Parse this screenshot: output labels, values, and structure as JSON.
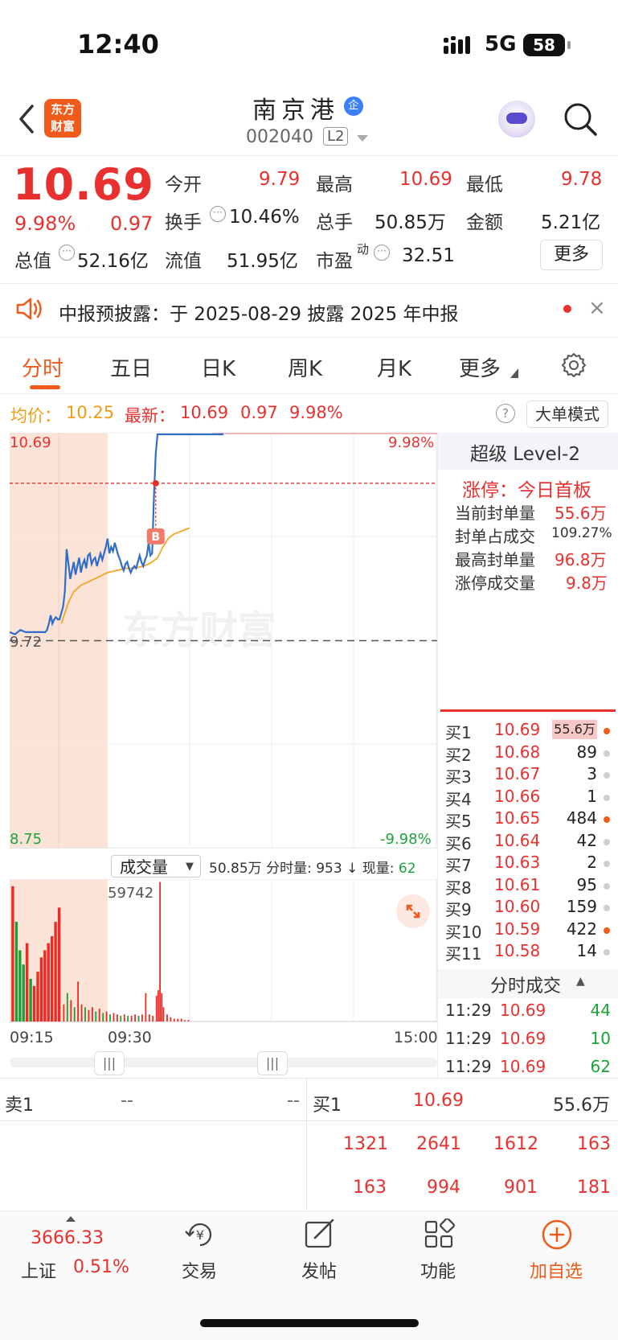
{
  "status_bar": {
    "time": "12:40",
    "network": "5G",
    "battery": "58"
  },
  "nav": {
    "logo_line1": "东方",
    "logo_line2": "财富",
    "stock_name": "南京港",
    "qi_badge": "企",
    "stock_code": "002040",
    "level_badge": "L2"
  },
  "quote": {
    "price": "10.69",
    "change_pct": "9.98%",
    "change_amt": "0.97",
    "stats": [
      {
        "label": "今开",
        "value": "9.79"
      },
      {
        "label": "最高",
        "value": "10.69"
      },
      {
        "label": "最低",
        "value": "9.78"
      },
      {
        "label": "换手",
        "value": "10.46%"
      },
      {
        "label": "总手",
        "value": "50.85万"
      },
      {
        "label": "金额",
        "value": "5.21亿"
      },
      {
        "label": "总值",
        "value": "52.16亿"
      },
      {
        "label": "流值",
        "value": "51.95亿"
      },
      {
        "label": "市盈",
        "sup": "动",
        "value": "32.51"
      }
    ],
    "more_label": "更多"
  },
  "notice": {
    "text": "中报预披露：于 2025-08-29 披露 2025 年中报",
    "close": "×"
  },
  "tabs": [
    {
      "label": "分时",
      "active": true
    },
    {
      "label": "五日"
    },
    {
      "label": "日K"
    },
    {
      "label": "周K"
    },
    {
      "label": "月K"
    },
    {
      "label": "更多"
    }
  ],
  "chart_header": {
    "avg_label": "均价：",
    "avg_value": "10.25",
    "latest_label": "最新：",
    "latest_value": "10.69",
    "latest_change": "0.97",
    "latest_pct": "9.98%",
    "help": "?",
    "big_order_mode": "大单模式"
  },
  "chart_data": {
    "type": "line",
    "title": "",
    "y_labels": {
      "top": "10.69",
      "mid": "9.72",
      "bottom": "8.75",
      "top_pct": "9.98%",
      "bottom_pct": "-9.98%"
    },
    "ylim": [
      8.75,
      10.69
    ],
    "prev_close": 9.72,
    "limit_line": 10.46,
    "x_labels": [
      "09:15",
      "09:30",
      "15:00"
    ],
    "watermark": "东方财富",
    "buy_marker": "B",
    "series": [
      {
        "x": [
          0,
          3,
          6,
          9,
          12,
          15,
          17,
          18,
          19,
          20,
          21,
          22,
          23,
          24,
          25,
          26,
          27,
          28,
          29,
          30,
          31,
          32,
          33,
          34,
          35,
          36,
          37,
          38,
          39,
          40,
          41,
          42,
          43,
          44,
          45,
          46,
          47,
          48,
          49,
          50,
          51,
          52,
          53,
          54,
          55,
          56,
          57,
          58,
          59,
          60,
          61,
          62,
          63,
          64,
          65,
          66,
          67,
          68,
          69,
          70,
          71,
          72,
          73,
          74,
          75,
          76,
          77,
          78,
          79,
          80,
          81,
          82,
          83,
          84,
          85,
          86,
          87,
          88,
          89,
          90,
          91,
          92,
          93,
          94,
          95,
          96,
          97,
          98,
          99,
          100,
          101,
          102,
          104,
          106,
          108,
          110,
          112,
          114,
          116,
          118,
          120
        ],
        "values": [
          9.76,
          9.75,
          9.77,
          9.76,
          9.76,
          9.76,
          9.76,
          9.76,
          9.76,
          9.76,
          9.77,
          9.8,
          9.84,
          9.8,
          9.82,
          9.83,
          9.82,
          9.82,
          9.85,
          9.88,
          9.95,
          10.15,
          10.08,
          10.01,
          10.05,
          10.09,
          10.03,
          10.07,
          10.11,
          10.04,
          10.08,
          10.1,
          10.06,
          10.12,
          10.13,
          10.08,
          10.1,
          10.11,
          10.07,
          10.1,
          10.13,
          10.1,
          10.13,
          10.16,
          10.2,
          10.13,
          10.16,
          10.14,
          10.18,
          10.15,
          10.12,
          10.1,
          10.07,
          10.05,
          10.08,
          10.09,
          10.06,
          10.04,
          10.06,
          10.07,
          10.06,
          10.09,
          10.12,
          10.09,
          10.07,
          10.1,
          10.12,
          10.18,
          10.12,
          10.13,
          10.4,
          10.6,
          10.69,
          10.69,
          10.69,
          10.69,
          10.69,
          10.69,
          10.69,
          10.69,
          10.69,
          10.69,
          10.69,
          10.69,
          10.69,
          10.69,
          10.69,
          10.69,
          10.69,
          10.69,
          10.69,
          10.69,
          10.69,
          10.69,
          10.69,
          10.69,
          10.69,
          10.69,
          10.69,
          10.69,
          10.69
        ]
      },
      {
        "x": [
          29,
          31,
          33,
          36,
          40,
          45,
          50,
          55,
          60,
          65,
          70,
          75,
          78,
          80,
          83,
          86,
          89,
          92,
          95,
          98,
          101
        ],
        "values": [
          9.8,
          9.85,
          9.9,
          9.95,
          9.98,
          10.0,
          10.02,
          10.04,
          10.05,
          10.06,
          10.06,
          10.07,
          10.08,
          10.09,
          10.11,
          10.16,
          10.2,
          10.22,
          10.23,
          10.24,
          10.25
        ]
      }
    ],
    "volume": {
      "label": "成交量",
      "total": "50.85万",
      "tick_label": "分时量:",
      "tick_value": "953",
      "now_label": "现量:",
      "now_value": "62",
      "peak_label": "59742",
      "bars": [
        {
          "x": 1,
          "v": 0.95,
          "c": "r"
        },
        {
          "x": 3,
          "v": 0.7,
          "c": "g"
        },
        {
          "x": 5,
          "v": 0.5,
          "c": "g"
        },
        {
          "x": 7,
          "v": 0.4,
          "c": "g"
        },
        {
          "x": 9,
          "v": 0.55,
          "c": "r"
        },
        {
          "x": 11,
          "v": 0.3,
          "c": "g"
        },
        {
          "x": 13,
          "v": 0.25,
          "c": "r"
        },
        {
          "x": 15,
          "v": 0.35,
          "c": "r"
        },
        {
          "x": 17,
          "v": 0.45,
          "c": "r"
        },
        {
          "x": 19,
          "v": 0.5,
          "c": "r"
        },
        {
          "x": 21,
          "v": 0.55,
          "c": "r"
        },
        {
          "x": 23,
          "v": 0.6,
          "c": "r"
        },
        {
          "x": 25,
          "v": 0.7,
          "c": "r"
        },
        {
          "x": 27,
          "v": 0.8,
          "c": "r"
        },
        {
          "x": 30,
          "v": 0.12,
          "c": "r"
        },
        {
          "x": 32,
          "v": 0.2,
          "c": "g"
        },
        {
          "x": 34,
          "v": 0.15,
          "c": "r"
        },
        {
          "x": 36,
          "v": 0.1,
          "c": "g"
        },
        {
          "x": 38,
          "v": 0.28,
          "c": "r"
        },
        {
          "x": 40,
          "v": 0.12,
          "c": "r"
        },
        {
          "x": 42,
          "v": 0.1,
          "c": "g"
        },
        {
          "x": 44,
          "v": 0.08,
          "c": "r"
        },
        {
          "x": 46,
          "v": 0.1,
          "c": "r"
        },
        {
          "x": 48,
          "v": 0.07,
          "c": "g"
        },
        {
          "x": 50,
          "v": 0.09,
          "c": "r"
        },
        {
          "x": 52,
          "v": 0.06,
          "c": "g"
        },
        {
          "x": 54,
          "v": 0.07,
          "c": "r"
        },
        {
          "x": 56,
          "v": 0.05,
          "c": "g"
        },
        {
          "x": 58,
          "v": 0.06,
          "c": "r"
        },
        {
          "x": 60,
          "v": 0.05,
          "c": "r"
        },
        {
          "x": 62,
          "v": 0.04,
          "c": "g"
        },
        {
          "x": 64,
          "v": 0.05,
          "c": "r"
        },
        {
          "x": 66,
          "v": 0.04,
          "c": "g"
        },
        {
          "x": 68,
          "v": 0.04,
          "c": "r"
        },
        {
          "x": 70,
          "v": 0.05,
          "c": "r"
        },
        {
          "x": 72,
          "v": 0.04,
          "c": "g"
        },
        {
          "x": 74,
          "v": 0.05,
          "c": "r"
        },
        {
          "x": 76,
          "v": 0.2,
          "c": "r"
        },
        {
          "x": 78,
          "v": 0.05,
          "c": "r"
        },
        {
          "x": 80,
          "v": 0.04,
          "c": "r"
        },
        {
          "x": 82,
          "v": 0.18,
          "c": "r"
        },
        {
          "x": 83,
          "v": 0.22,
          "c": "r"
        },
        {
          "x": 84,
          "v": 0.98,
          "c": "r"
        },
        {
          "x": 85,
          "v": 0.2,
          "c": "r"
        },
        {
          "x": 86,
          "v": 0.1,
          "c": "r"
        },
        {
          "x": 88,
          "v": 0.05,
          "c": "r"
        },
        {
          "x": 90,
          "v": 0.03,
          "c": "r"
        },
        {
          "x": 92,
          "v": 0.02,
          "c": "r"
        },
        {
          "x": 94,
          "v": 0.02,
          "c": "r"
        },
        {
          "x": 96,
          "v": 0.02,
          "c": "r"
        },
        {
          "x": 98,
          "v": 0.01,
          "c": "r"
        },
        {
          "x": 100,
          "v": 0.01,
          "c": "r"
        }
      ]
    }
  },
  "right_panel": {
    "title": "超级 Level-2",
    "limit_title": "涨停：今日首板",
    "limit_stats": [
      {
        "label": "当前封单量",
        "value": "55.6万"
      },
      {
        "label": "封单占成交",
        "value": "109.27%"
      },
      {
        "label": "最高封单量",
        "value": "96.8万"
      },
      {
        "label": "涨停成交量",
        "value": "9.8万"
      }
    ],
    "order_book": [
      {
        "label": "买1",
        "price": "10.69",
        "vol": "55.6万",
        "dot": "red"
      },
      {
        "label": "买2",
        "price": "10.68",
        "vol": "89",
        "dot": "gray"
      },
      {
        "label": "买3",
        "price": "10.67",
        "vol": "3",
        "dot": "gray"
      },
      {
        "label": "买4",
        "price": "10.66",
        "vol": "1",
        "dot": "gray"
      },
      {
        "label": "买5",
        "price": "10.65",
        "vol": "484",
        "dot": "red"
      },
      {
        "label": "买6",
        "price": "10.64",
        "vol": "42",
        "dot": "gray"
      },
      {
        "label": "买7",
        "price": "10.63",
        "vol": "2",
        "dot": "gray"
      },
      {
        "label": "买8",
        "price": "10.61",
        "vol": "95",
        "dot": "gray"
      },
      {
        "label": "买9",
        "price": "10.60",
        "vol": "159",
        "dot": "gray"
      },
      {
        "label": "买10",
        "price": "10.59",
        "vol": "422",
        "dot": "red"
      },
      {
        "label": "买11",
        "price": "10.58",
        "vol": "14",
        "dot": "gray"
      }
    ],
    "ticks_title": "分时成交",
    "ticks": [
      {
        "time": "11:29",
        "price": "10.69",
        "vol": "44"
      },
      {
        "time": "11:29",
        "price": "10.69",
        "vol": "10"
      },
      {
        "time": "11:29",
        "price": "10.69",
        "vol": "62"
      }
    ]
  },
  "queue": {
    "sell_label": "卖1",
    "sell_price": "--",
    "sell_vol": "--",
    "buy_label": "买1",
    "buy_price": "10.69",
    "buy_vol": "55.6万",
    "row1": [
      "1321",
      "2641",
      "1612",
      "163"
    ],
    "row2": [
      "163",
      "994",
      "901",
      "181"
    ]
  },
  "bottom_nav": {
    "index_value": "3666.33",
    "index_name": "上证",
    "index_pct": "0.51%",
    "items": [
      {
        "label": "交易",
        "icon": "yen-cycle-icon"
      },
      {
        "label": "发帖",
        "icon": "edit-icon"
      },
      {
        "label": "功能",
        "icon": "grid-icon"
      },
      {
        "label": "加自选",
        "icon": "plus-circle-icon"
      }
    ]
  }
}
